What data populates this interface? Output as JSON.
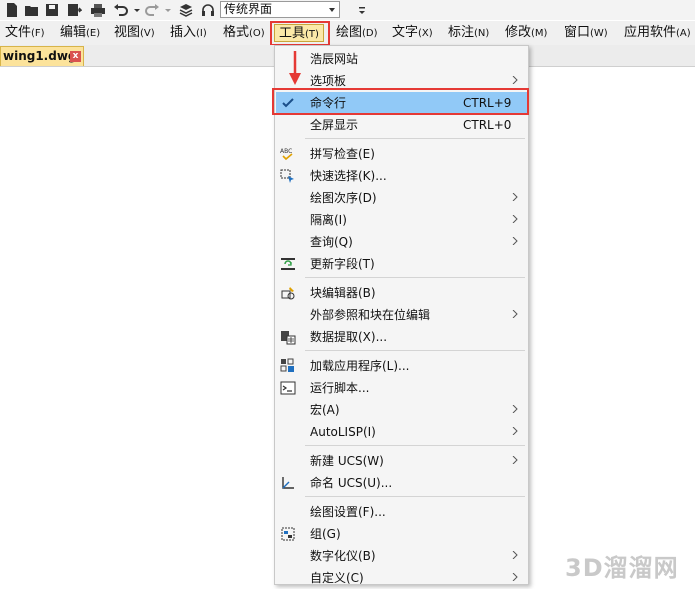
{
  "toolbar": {
    "workspace_value": "传统界面",
    "icons": [
      "new-file-icon",
      "open-folder-icon",
      "save-icon",
      "save-as-icon",
      "print-icon",
      "undo-icon",
      "redo-icon",
      "layers-icon",
      "headphones-icon"
    ]
  },
  "menubar": {
    "items": [
      {
        "label": "文件",
        "acc": "(F)"
      },
      {
        "label": "编辑",
        "acc": "(E)"
      },
      {
        "label": "视图",
        "acc": "(V)"
      },
      {
        "label": "插入",
        "acc": "(I)"
      },
      {
        "label": "格式",
        "acc": "(O)"
      },
      {
        "label": "工具",
        "acc": "(T)"
      },
      {
        "label": "绘图",
        "acc": "(D)"
      },
      {
        "label": "文字",
        "acc": "(X)"
      },
      {
        "label": "标注",
        "acc": "(N)"
      },
      {
        "label": "修改",
        "acc": "(M)"
      },
      {
        "label": "窗口",
        "acc": "(W)"
      },
      {
        "label": "应用软件",
        "acc": "(A)"
      }
    ]
  },
  "document_tab": {
    "label": "wing1.dwg",
    "close": "x"
  },
  "dropdown": {
    "items": [
      {
        "label": "浩辰网站",
        "shortcut": "",
        "submenu": false
      },
      {
        "label": "选项板",
        "shortcut": "",
        "submenu": true
      },
      {
        "label": "命令行",
        "shortcut": "CTRL+9",
        "submenu": false,
        "checked": true
      },
      {
        "label": "全屏显示",
        "shortcut": "CTRL+0",
        "submenu": false
      },
      {
        "label": "拼写检查(E)",
        "shortcut": "",
        "submenu": false
      },
      {
        "label": "快速选择(K)...",
        "shortcut": "",
        "submenu": false
      },
      {
        "label": "绘图次序(D)",
        "shortcut": "",
        "submenu": true
      },
      {
        "label": "隔离(I)",
        "shortcut": "",
        "submenu": true
      },
      {
        "label": "查询(Q)",
        "shortcut": "",
        "submenu": true
      },
      {
        "label": "更新字段(T)",
        "shortcut": "",
        "submenu": false
      },
      {
        "label": "块编辑器(B)",
        "shortcut": "",
        "submenu": false
      },
      {
        "label": "外部参照和块在位编辑",
        "shortcut": "",
        "submenu": true
      },
      {
        "label": "数据提取(X)...",
        "shortcut": "",
        "submenu": false
      },
      {
        "label": "加载应用程序(L)...",
        "shortcut": "",
        "submenu": false
      },
      {
        "label": "运行脚本...",
        "shortcut": "",
        "submenu": false
      },
      {
        "label": "宏(A)",
        "shortcut": "",
        "submenu": true
      },
      {
        "label": "AutoLISP(I)",
        "shortcut": "",
        "submenu": true
      },
      {
        "label": "新建 UCS(W)",
        "shortcut": "",
        "submenu": true
      },
      {
        "label": "命名 UCS(U)...",
        "shortcut": "",
        "submenu": false
      },
      {
        "label": "绘图设置(F)...",
        "shortcut": "",
        "submenu": false
      },
      {
        "label": "组(G)",
        "shortcut": "",
        "submenu": false
      },
      {
        "label": "数字化仪(B)",
        "shortcut": "",
        "submenu": true
      },
      {
        "label": "自定义(C)",
        "shortcut": "",
        "submenu": true
      }
    ]
  },
  "watermark": "3D溜溜网",
  "colors": {
    "highlight": "#91c9f7",
    "annotation_red": "#e53935",
    "active_menu": "#fbe9a8",
    "tab": "#fce39b"
  }
}
